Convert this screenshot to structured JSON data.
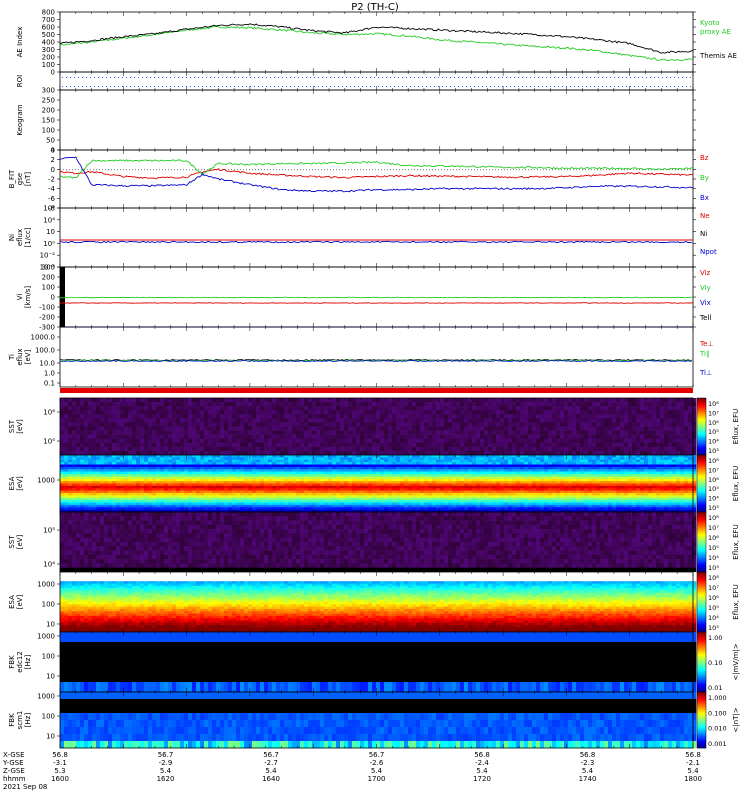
{
  "title": "P2 (TH-C)",
  "colors": {
    "green": "#22cc22",
    "black": "#000000",
    "red": "#dd0000",
    "blue": "#0000cc",
    "axis": "#000000"
  },
  "chart_data": [
    {
      "type": "line",
      "panel": "AE Index",
      "ylabel": "AE Index",
      "yticks": [
        "0",
        "100",
        "200",
        "300",
        "400",
        "500",
        "600",
        "700",
        "800"
      ],
      "ylim": [
        0,
        800
      ],
      "series": [
        {
          "name": "Kyoto proxy AE",
          "color": "green",
          "x": [
            1600,
            1610,
            1620,
            1630,
            1640,
            1650,
            1660,
            1670,
            1680,
            1690,
            1700,
            1710,
            1720,
            1730,
            1740,
            1750,
            1760,
            1770,
            1780,
            1790,
            1800
          ],
          "values": [
            360,
            400,
            450,
            500,
            560,
            600,
            590,
            560,
            520,
            500,
            510,
            480,
            430,
            400,
            370,
            340,
            320,
            280,
            220,
            160,
            170
          ]
        },
        {
          "name": "Themis AE",
          "color": "black",
          "x": [
            1600,
            1610,
            1620,
            1630,
            1640,
            1650,
            1660,
            1670,
            1680,
            1690,
            1700,
            1710,
            1720,
            1730,
            1740,
            1750,
            1760,
            1770,
            1780,
            1790,
            1800
          ],
          "values": [
            380,
            420,
            470,
            510,
            570,
            620,
            640,
            600,
            550,
            520,
            600,
            580,
            560,
            540,
            520,
            500,
            470,
            430,
            380,
            260,
            280
          ]
        }
      ],
      "legend_labels": [
        "Kyoto",
        "proxy AE",
        "Themis AE"
      ]
    },
    {
      "type": "line",
      "panel": "ROI",
      "ylabel": "ROI"
    },
    {
      "type": "line",
      "panel": "Keogram",
      "ylabel": "Keogram",
      "yticks": [
        "0",
        "50",
        "100",
        "150",
        "200",
        "250",
        "300"
      ]
    },
    {
      "type": "line",
      "panel": "B FIT",
      "ylabel": "B_FIT",
      "ylabel2": "gse",
      "ylabel3": "[nT]",
      "yticks": [
        "-8",
        "-6",
        "-4",
        "-2",
        "0",
        "2",
        "4"
      ],
      "ylim": [
        -8,
        4
      ],
      "series": [
        {
          "name": "Bz",
          "color": "red",
          "x": [
            1600,
            1605,
            1610,
            1620,
            1630,
            1640,
            1645,
            1650,
            1660,
            1670,
            1680,
            1690,
            1700,
            1710,
            1720,
            1730,
            1740,
            1750,
            1760,
            1770,
            1780,
            1790,
            1800
          ],
          "values": [
            -0.5,
            -0.8,
            -0.5,
            -1.5,
            -1.8,
            -1.6,
            -0.5,
            0,
            -0.8,
            -1.2,
            -1.5,
            -1.7,
            -1.5,
            -1.3,
            -1.4,
            -1.5,
            -1.6,
            -1.6,
            -1.5,
            -1.2,
            -0.8,
            -1.0,
            -1.2
          ]
        },
        {
          "name": "By",
          "color": "green",
          "x": [
            1600,
            1605,
            1610,
            1620,
            1630,
            1640,
            1645,
            1650,
            1660,
            1670,
            1680,
            1690,
            1700,
            1710,
            1720,
            1730,
            1740,
            1750,
            1760,
            1770,
            1780,
            1790,
            1800
          ],
          "values": [
            -1.5,
            -1.8,
            1.8,
            1.8,
            1.8,
            1.8,
            -1.0,
            1.2,
            1.0,
            1.2,
            1.2,
            1.3,
            1.5,
            0.8,
            0.7,
            0.6,
            0.4,
            0.4,
            0.2,
            0.2,
            0.2,
            0.0,
            0.2
          ]
        },
        {
          "name": "Bx",
          "color": "blue",
          "x": [
            1600,
            1605,
            1610,
            1620,
            1630,
            1640,
            1645,
            1650,
            1660,
            1670,
            1680,
            1690,
            1700,
            1710,
            1720,
            1730,
            1740,
            1750,
            1760,
            1770,
            1780,
            1790,
            1800
          ],
          "values": [
            2.2,
            2.5,
            -3.2,
            -3.4,
            -3.4,
            -3.2,
            -1.0,
            -2.0,
            -3.2,
            -4.2,
            -4.5,
            -4.5,
            -4.2,
            -4.2,
            -4.0,
            -4.0,
            -4.0,
            -4.0,
            -3.8,
            -3.5,
            -3.5,
            -3.6,
            -3.8
          ]
        }
      ],
      "legend_labels": [
        "Bz",
        "By",
        "Bx"
      ]
    },
    {
      "type": "line",
      "panel": "Ni",
      "ylabel": "Ni",
      "ylabel2": "eflux",
      "ylabel3": "[1/cc]",
      "yticks": [
        "10⁶",
        "10⁴",
        "10⁲",
        "10⁰",
        "10⁻²",
        "10⁻⁴"
      ],
      "legend_labels": [
        "Ne",
        "Ni",
        "Npot"
      ]
    },
    {
      "type": "line",
      "panel": "Vi",
      "ylabel": "Vi",
      "ylabel2": "[km/s]",
      "yticks": [
        "300",
        "200",
        "100",
        "0",
        "-100",
        "-200",
        "-300"
      ],
      "ylim": [
        -300,
        300
      ],
      "series": [
        {
          "name": "Viz",
          "color": "red",
          "x": [
            1600,
            1800
          ],
          "values": [
            -60,
            -60
          ]
        },
        {
          "name": "Viy",
          "color": "green",
          "x": [
            1600,
            1800
          ],
          "values": [
            -5,
            -5
          ]
        },
        {
          "name": "Vix",
          "color": "blue",
          "x": [
            1600,
            1800
          ],
          "values": [
            -310,
            -310
          ]
        }
      ],
      "legend_labels": [
        "Viz",
        "Viy",
        "Vix",
        "Tell"
      ]
    },
    {
      "type": "line",
      "panel": "Ti",
      "ylabel": "Ti",
      "ylabel2": "eflux",
      "ylabel3": "[eV]",
      "yticks": [
        "1000.0",
        "100.0",
        "10.0",
        "1.0",
        "0.1"
      ],
      "legend_labels": [
        "Te⊥",
        "Ti∥",
        "Ti⊥"
      ]
    },
    {
      "type": "heatmap",
      "panel": "SST ion",
      "ylabel": "SST",
      "ylabel2": "[eV]",
      "yticks": [
        "10⁶",
        "10⁵"
      ],
      "colorbar_label": "Eflux, EFU",
      "colorbar_ticks": [
        "10⁸",
        "10⁷",
        "10⁶",
        "10⁵",
        "10⁴",
        "10³"
      ]
    },
    {
      "type": "heatmap",
      "panel": "ESA ion",
      "ylabel": "ESA",
      "ylabel2": "[eV]",
      "yticks": [
        "1000"
      ],
      "colorbar_label": "Eflux, EFU",
      "colorbar_ticks": [
        "10⁸",
        "10⁷",
        "10⁶",
        "10⁵",
        "10⁴",
        "10³"
      ]
    },
    {
      "type": "heatmap",
      "panel": "SST electron",
      "ylabel": "SST",
      "ylabel2": "[eV]",
      "yticks": [
        "10⁵",
        "10⁴"
      ],
      "colorbar_label": "Eflux, EFU",
      "colorbar_ticks": [
        "10⁸",
        "10⁷",
        "10⁶",
        "10⁵",
        "10⁴",
        "10³"
      ]
    },
    {
      "type": "heatmap",
      "panel": "ESA electron",
      "ylabel": "ESA",
      "ylabel2": "[eV]",
      "yticks": [
        "1000",
        "100",
        "10"
      ],
      "colorbar_label": "Eflux, EFU",
      "colorbar_ticks": [
        "10⁸",
        "10⁷",
        "10⁶",
        "10⁵",
        "10⁴",
        "10³"
      ]
    },
    {
      "type": "heatmap",
      "panel": "FBK edc12",
      "ylabel": "FBK",
      "ylabel2": "edc12",
      "ylabel3": "[Hz]",
      "yticks": [
        "1000",
        "100",
        "10"
      ],
      "colorbar_label": "<|mV/m|>",
      "colorbar_ticks": [
        "1.00",
        "0.10",
        "0.01"
      ]
    },
    {
      "type": "heatmap",
      "panel": "FBK scm1",
      "ylabel": "FBK",
      "ylabel2": "scm1",
      "ylabel3": "[Hz]",
      "yticks": [
        "1000",
        "100",
        "10"
      ],
      "colorbar_label": "<|nT|>",
      "colorbar_ticks": [
        "1.000",
        "0.100",
        "0.010",
        "0.001"
      ]
    }
  ],
  "x_axis": {
    "row_labels": [
      "X-GSE",
      "Y-GSE",
      "Z-GSE",
      "hhmm",
      "2021 Sep 08"
    ],
    "columns": [
      [
        "56.8",
        "-3.1",
        "5.3",
        "1600"
      ],
      [
        "56.7",
        "-2.9",
        "5.4",
        "1620"
      ],
      [
        "56.7",
        "-2.7",
        "5.4",
        "1640"
      ],
      [
        "56.7",
        "-2.6",
        "5.4",
        "1700"
      ],
      [
        "56.8",
        "-2.4",
        "5.4",
        "1720"
      ],
      [
        "56.8",
        "-2.3",
        "5.4",
        "1740"
      ],
      [
        "56.8",
        "-2.1",
        "5.4",
        "1800"
      ]
    ]
  }
}
